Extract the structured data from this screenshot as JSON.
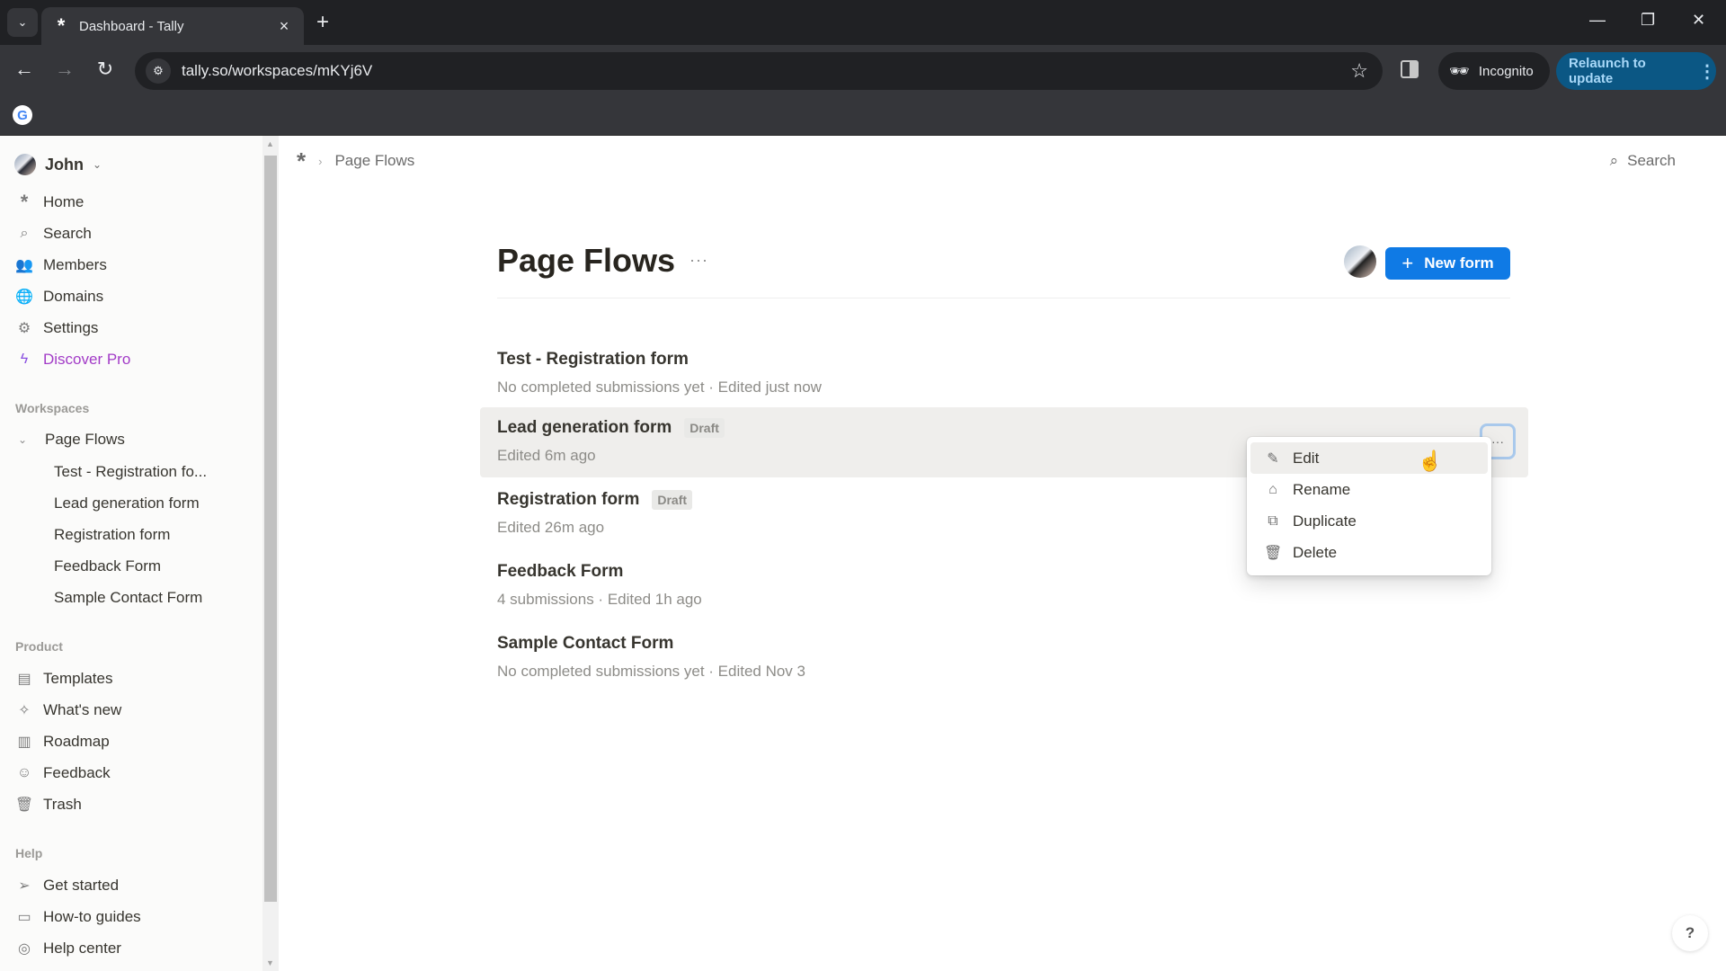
{
  "browser": {
    "tab_title": "Dashboard - Tally",
    "url": "tally.so/workspaces/mKYj6V",
    "incognito_label": "Incognito",
    "relaunch_label": "Relaunch to update"
  },
  "sidebar": {
    "user_name": "John",
    "nav": [
      {
        "label": "Home",
        "icon": "tally-asterisk-icon"
      },
      {
        "label": "Search",
        "icon": "search-icon"
      },
      {
        "label": "Members",
        "icon": "users-icon"
      },
      {
        "label": "Domains",
        "icon": "globe-icon"
      },
      {
        "label": "Settings",
        "icon": "gear-icon"
      },
      {
        "label": "Discover Pro",
        "icon": "lightning-icon"
      }
    ],
    "workspaces_label": "Workspaces",
    "workspace": {
      "name": "Page Flows",
      "forms": [
        "Test - Registration fo...",
        "Lead generation form",
        "Registration form",
        "Feedback Form",
        "Sample Contact Form"
      ]
    },
    "product_label": "Product",
    "product": [
      {
        "label": "Templates",
        "icon": "templates-icon"
      },
      {
        "label": "What's new",
        "icon": "sparkle-icon"
      },
      {
        "label": "Roadmap",
        "icon": "map-icon"
      },
      {
        "label": "Feedback",
        "icon": "smiley-icon"
      },
      {
        "label": "Trash",
        "icon": "trash-icon"
      }
    ],
    "help_label": "Help",
    "help": [
      {
        "label": "Get started",
        "icon": "send-icon"
      },
      {
        "label": "How-to guides",
        "icon": "book-icon"
      },
      {
        "label": "Help center",
        "icon": "lifebuoy-icon"
      }
    ]
  },
  "main": {
    "breadcrumb": "Page Flows",
    "search_label": "Search",
    "title": "Page Flows",
    "new_form_label": "New form",
    "forms": [
      {
        "name": "Test - Registration form",
        "badge": null,
        "meta": "No completed submissions yet · Edited just now"
      },
      {
        "name": "Lead generation form",
        "badge": "Draft",
        "meta": "Edited 6m ago"
      },
      {
        "name": "Registration form",
        "badge": "Draft",
        "meta": "Edited 26m ago"
      },
      {
        "name": "Feedback Form",
        "badge": null,
        "meta": "4 submissions · Edited 1h ago"
      },
      {
        "name": "Sample Contact Form",
        "badge": null,
        "meta": "No completed submissions yet · Edited Nov 3"
      }
    ],
    "context_menu": [
      {
        "label": "Edit",
        "icon": "pencil-icon"
      },
      {
        "label": "Rename",
        "icon": "tag-icon"
      },
      {
        "label": "Duplicate",
        "icon": "copy-icon"
      },
      {
        "label": "Delete",
        "icon": "trash-icon"
      }
    ],
    "help_button": "?"
  },
  "colors": {
    "accent": "#0f7ae5",
    "pro": "#a23bc7",
    "relaunch_bg": "#0b5784"
  }
}
